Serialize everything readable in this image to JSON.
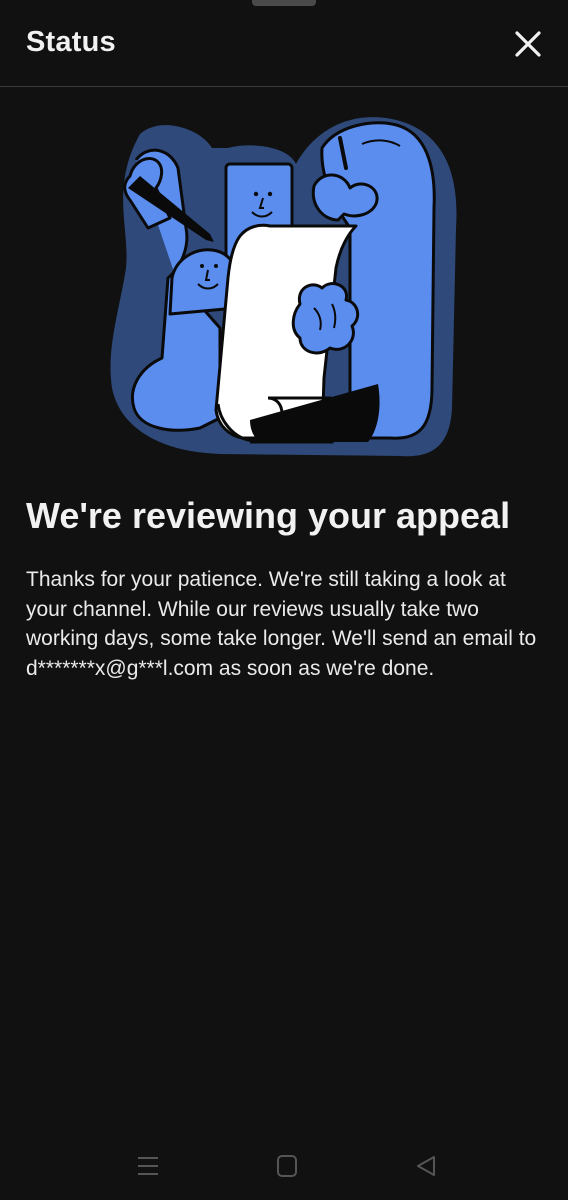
{
  "header": {
    "title": "Status",
    "close_icon": "close-icon"
  },
  "status": {
    "headline": "We're reviewing your appeal",
    "message": "Thanks for your patience. We're still taking a look at your channel. While our reviews usually take two working days, some take longer. We'll send an email to d*******x@g***l.com as soon as we're done."
  },
  "navigation": {
    "icons": [
      "menu-icon",
      "home-icon",
      "back-icon"
    ]
  },
  "colors": {
    "background": "#111112",
    "illustration_blue": "#5b8def",
    "illustration_outline": "#2f4a7a",
    "text": "#f1f1f1"
  }
}
